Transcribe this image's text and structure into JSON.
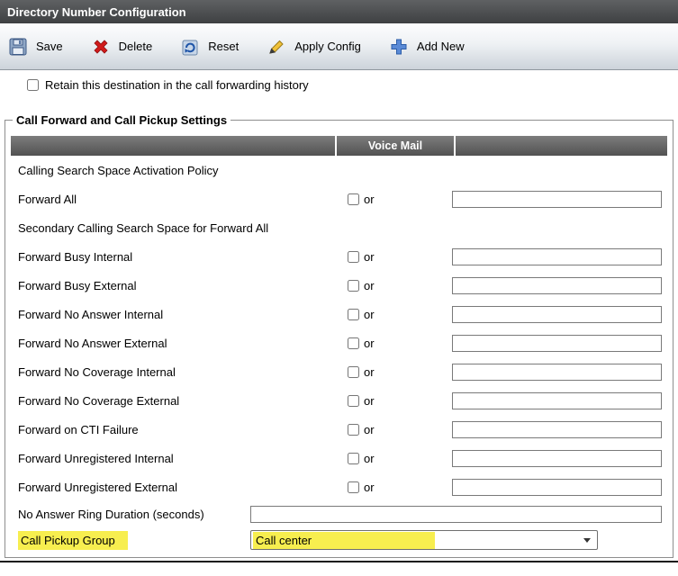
{
  "title_bar": {
    "title": "Directory Number Configuration"
  },
  "toolbar": {
    "buttons": [
      {
        "label": "Save"
      },
      {
        "label": "Delete"
      },
      {
        "label": "Reset"
      },
      {
        "label": "Apply Config"
      },
      {
        "label": "Add New"
      }
    ]
  },
  "retain": {
    "label": "Retain this destination in the call forwarding history",
    "checked": false
  },
  "section": {
    "legend": "Call Forward and Call Pickup Settings",
    "table": {
      "voice_mail_header": "Voice Mail",
      "or_label": "or",
      "rows": [
        {
          "label": "Calling Search Space Activation Policy",
          "type": "plain"
        },
        {
          "label": "Forward All",
          "type": "forward",
          "checked": false,
          "value": ""
        },
        {
          "label": "Secondary Calling Search Space for Forward All",
          "type": "plain"
        },
        {
          "label": "Forward Busy Internal",
          "type": "forward",
          "checked": false,
          "value": ""
        },
        {
          "label": "Forward Busy External",
          "type": "forward",
          "checked": false,
          "value": ""
        },
        {
          "label": "Forward No Answer Internal",
          "type": "forward",
          "checked": false,
          "value": ""
        },
        {
          "label": "Forward No Answer External",
          "type": "forward",
          "checked": false,
          "value": ""
        },
        {
          "label": "Forward No Coverage Internal",
          "type": "forward",
          "checked": false,
          "value": ""
        },
        {
          "label": "Forward No Coverage External",
          "type": "forward",
          "checked": false,
          "value": ""
        },
        {
          "label": "Forward on CTI Failure",
          "type": "forward",
          "checked": false,
          "value": ""
        },
        {
          "label": "Forward Unregistered Internal",
          "type": "forward",
          "checked": false,
          "value": ""
        },
        {
          "label": "Forward Unregistered External",
          "type": "forward",
          "checked": false,
          "value": ""
        }
      ]
    },
    "no_answer_ring": {
      "label": "No Answer Ring Duration (seconds)",
      "value": ""
    },
    "call_pickup": {
      "label": "Call Pickup Group",
      "selected": "Call center"
    },
    "highlight_color": "#f7ee4f"
  }
}
